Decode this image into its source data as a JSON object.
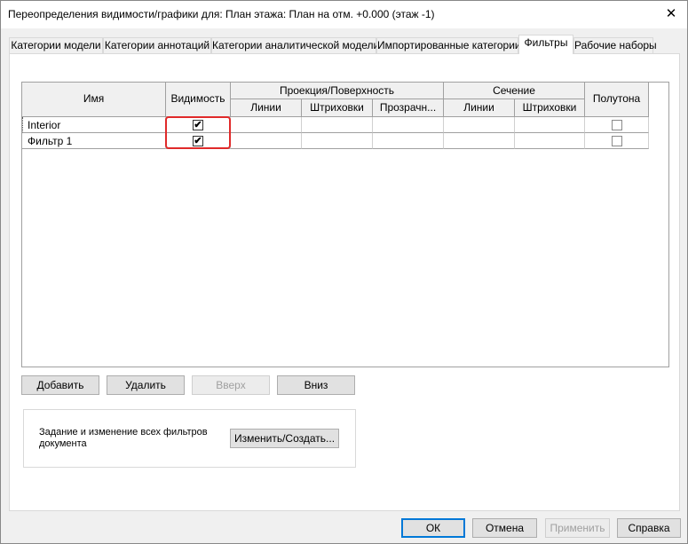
{
  "window": {
    "title": "Переопределения видимости/графики для: План этажа: План на отм. +0.000 (этаж -1)",
    "close_glyph": "✕"
  },
  "tabs": [
    {
      "label": "Категории модели",
      "active": false
    },
    {
      "label": "Категории аннотаций",
      "active": false
    },
    {
      "label": "Категории аналитической модели",
      "active": false
    },
    {
      "label": "Импортированные категории",
      "active": false
    },
    {
      "label": "Фильтры",
      "active": true
    },
    {
      "label": "Рабочие наборы",
      "active": false
    }
  ],
  "grid": {
    "headers": {
      "name": "Имя",
      "visibility": "Видимость",
      "projection_group": "Проекция/Поверхность",
      "proj_lines": "Линии",
      "proj_patterns": "Штриховки",
      "proj_transparency": "Прозрачн...",
      "section_group": "Сечение",
      "sec_lines": "Линии",
      "sec_patterns": "Штриховки",
      "halftone": "Полутона"
    },
    "rows": [
      {
        "name": "Interior",
        "visible": true,
        "halftone": false
      },
      {
        "name": "Фильтр 1",
        "visible": true,
        "halftone": false
      }
    ],
    "check_glyph": "✔"
  },
  "filter_buttons": {
    "add": "Добавить",
    "remove": "Удалить",
    "up": "Вверх",
    "down": "Вниз"
  },
  "edit_group": {
    "text": "Задание и изменение всех фильтров документа",
    "button": "Изменить/Создать..."
  },
  "dialog_buttons": {
    "ok": "ОК",
    "cancel": "Отмена",
    "apply": "Применить",
    "help": "Справка"
  },
  "colors": {
    "highlight": "#e02a2a",
    "default_button_border": "#0078d7"
  }
}
